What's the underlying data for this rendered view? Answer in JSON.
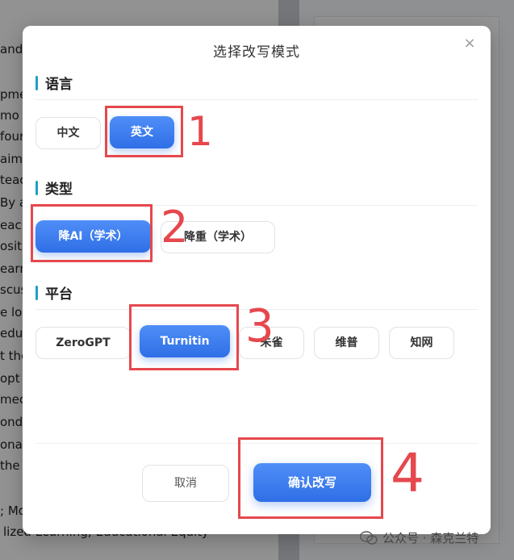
{
  "background": {
    "lines": [
      "and",
      "pme",
      "mo",
      "four",
      "aims",
      "teac",
      "By a",
      "eac",
      "osit",
      "earn",
      "scus",
      "e lo",
      "edu",
      "t the",
      "opt",
      "mec",
      "ond",
      "ona",
      "the",
      "; Mo",
      "lized Learning; Educational Equity"
    ]
  },
  "modal": {
    "title": "选择改写模式",
    "close_label": "×",
    "sections": {
      "language": {
        "heading": "语言",
        "options": [
          "中文",
          "英文"
        ],
        "selected": "英文"
      },
      "type": {
        "heading": "类型",
        "options": [
          "降AI（学术）",
          "降重（学术）"
        ],
        "selected": "降AI（学术）"
      },
      "platform": {
        "heading": "平台",
        "options": [
          "ZeroGPT",
          "Turnitin",
          "朱雀",
          "维普",
          "知网"
        ],
        "selected": "Turnitin"
      }
    },
    "cancel_label": "取消",
    "confirm_label": "确认改写"
  },
  "annotations": [
    "1",
    "2",
    "3",
    "4"
  ],
  "watermark": {
    "text": "公众号 · 森克兰特"
  },
  "colors": {
    "accent": "#2f6fe6",
    "section_bar": "#1da1c6",
    "annotation": "#e5484d"
  }
}
